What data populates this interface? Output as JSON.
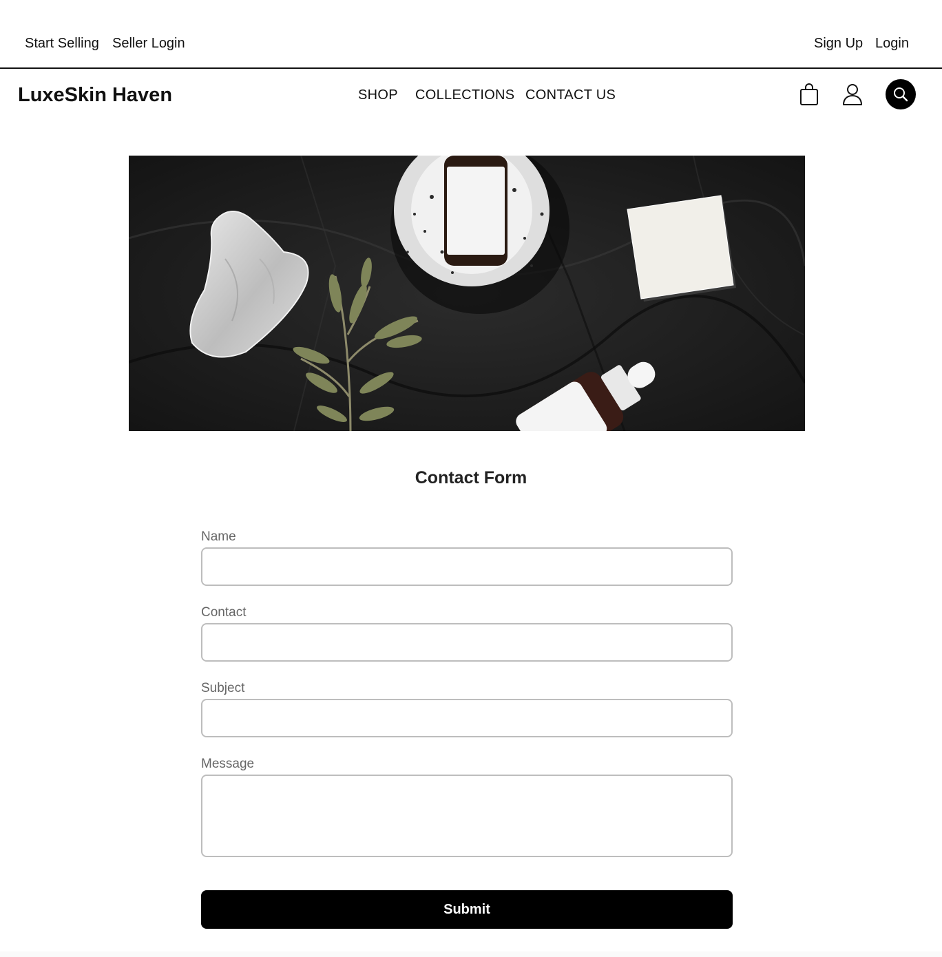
{
  "topbar": {
    "start_selling": "Start Selling",
    "seller_login": "Seller Login",
    "sign_up": "Sign Up",
    "login": "Login"
  },
  "header": {
    "brand": "LuxeSkin Haven",
    "nav": [
      "SHOP",
      "COLLECTIONS",
      "CONTACT US"
    ],
    "icons": [
      "shopping-bag-icon",
      "user-icon",
      "search-icon"
    ]
  },
  "hero": {
    "image": "flat-lay of skincare products on dark linen: gua sha stone, olive branch, serum bottle in speckled dish, white soap bar, dropper bottle"
  },
  "form": {
    "title": "Contact Form",
    "fields": [
      {
        "label": "Name",
        "value": ""
      },
      {
        "label": "Contact",
        "value": ""
      },
      {
        "label": "Subject",
        "value": ""
      },
      {
        "label": "Message",
        "value": ""
      }
    ],
    "submit": "Submit"
  },
  "colors": {
    "accent": "#000000",
    "border": "#bdbdbd",
    "label": "#666666"
  }
}
